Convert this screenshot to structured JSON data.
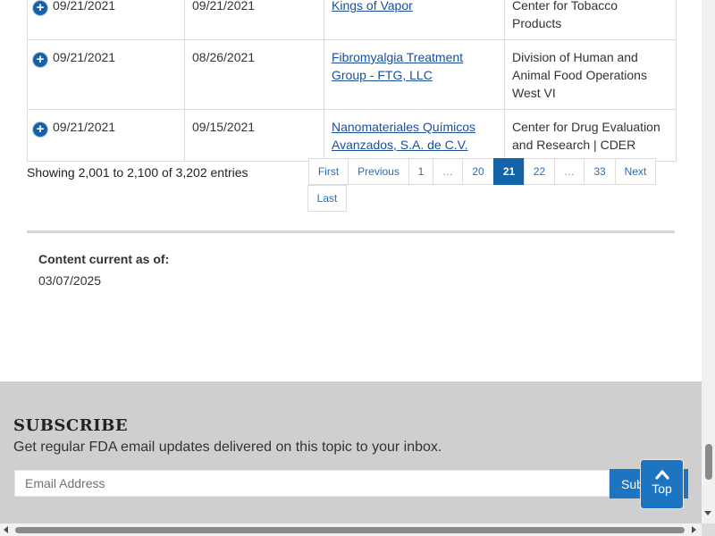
{
  "table": {
    "rows": [
      {
        "posted": "09/21/2021",
        "letter_issue": "09/21/2021",
        "firm": "Kings of Vapor",
        "subject": "Center for Tobacco Products"
      },
      {
        "posted": "09/21/2021",
        "letter_issue": "08/26/2021",
        "firm": "Fibromyalgia Treatment Group - FTG, LLC",
        "subject": "Division of Human and Animal Food Operations West VI"
      },
      {
        "posted": "09/21/2021",
        "letter_issue": "09/15/2021",
        "firm": "Nanomateriales Químicos Avanzados, S.A. de C.V.",
        "subject": "Center for Drug Evaluation and Research | CDER"
      }
    ]
  },
  "info_text": "Showing 2,001 to 2,100 of 3,202 entries",
  "pagination": {
    "first": "First",
    "previous": "Previous",
    "pages": [
      "1",
      "…",
      "20",
      "21",
      "22",
      "…",
      "33"
    ],
    "current": "21",
    "next": "Next",
    "last": "Last"
  },
  "content_current": {
    "label": "Content current as of:",
    "date": "03/07/2025"
  },
  "subscribe": {
    "title": "SUBSCRIBE",
    "description": "Get regular FDA email updates delivered on this topic to your inbox.",
    "email_placeholder": "Email Address",
    "button_label": "Subscribe"
  },
  "back_to_top": {
    "label": "Top",
    "icon": "chevron-up-icon"
  },
  "colors": {
    "accent_blue": "#1463a8",
    "link_blue": "#1a4f9c",
    "subscribe_bg": "#cfcfcf",
    "button_blue": "#1d74c0"
  }
}
